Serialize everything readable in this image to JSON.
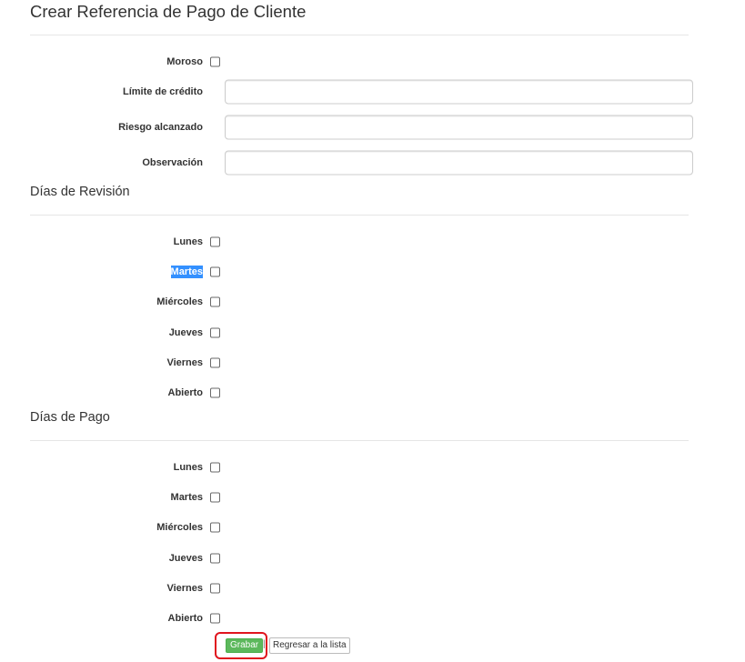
{
  "page": {
    "title": "Crear Referencia de Pago de Cliente"
  },
  "general": {
    "moroso_label": "Moroso",
    "credit_limit_label": "Límite de crédito",
    "credit_limit_value": "",
    "risk_label": "Riesgo alcanzado",
    "risk_value": "",
    "observation_label": "Observación",
    "observation_value": ""
  },
  "revision": {
    "title": "Días de Revisión",
    "days": [
      {
        "label": "Lunes",
        "checked": false
      },
      {
        "label": "Martes",
        "checked": false,
        "selected_text": true
      },
      {
        "label": "Miércoles",
        "checked": false
      },
      {
        "label": "Jueves",
        "checked": false
      },
      {
        "label": "Viernes",
        "checked": false
      },
      {
        "label": "Abierto",
        "checked": false
      }
    ]
  },
  "payment": {
    "title": "Días de Pago",
    "days": [
      {
        "label": "Lunes",
        "checked": false
      },
      {
        "label": "Martes",
        "checked": false
      },
      {
        "label": "Miércoles",
        "checked": false
      },
      {
        "label": "Jueves",
        "checked": false
      },
      {
        "label": "Viernes",
        "checked": false
      },
      {
        "label": "Abierto",
        "checked": false
      }
    ]
  },
  "actions": {
    "save_label": "Grabar",
    "separator": "|",
    "back_label": "Regresar a la lista"
  },
  "colors": {
    "save_button": "#5cb85c",
    "selection_highlight": "#3390ff",
    "annotation_outline": "#e0141e"
  }
}
